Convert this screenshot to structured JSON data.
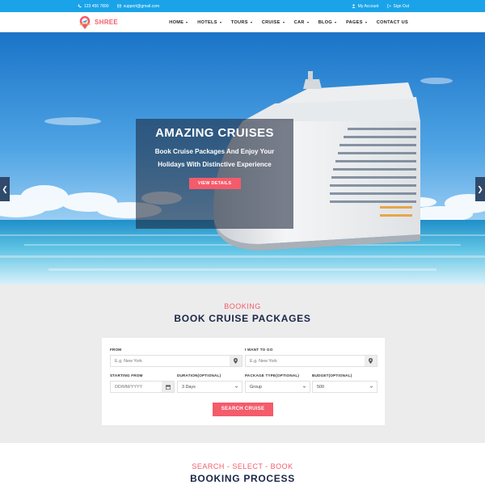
{
  "topbar": {
    "phone": "123 456 7890",
    "email": "support@gmail.com",
    "account": "My Account",
    "signout": "Sign Out"
  },
  "logo": {
    "text": "SHREE"
  },
  "menu": [
    {
      "label": "HOME",
      "dropdown": true
    },
    {
      "label": "HOTELS",
      "dropdown": true
    },
    {
      "label": "TOURS",
      "dropdown": true
    },
    {
      "label": "CRUISE",
      "dropdown": true
    },
    {
      "label": "CAR",
      "dropdown": true
    },
    {
      "label": "BLOG",
      "dropdown": true
    },
    {
      "label": "PAGES",
      "dropdown": true
    },
    {
      "label": "CONTACT US",
      "dropdown": false
    }
  ],
  "hero": {
    "title": "AMAZING CRUISES",
    "text": "Book Cruise Packages And Enjoy Your Holidays With Distinctive Experience",
    "button": "VIEW DETAILS"
  },
  "booking": {
    "subtitle": "BOOKING",
    "title": "BOOK CRUISE PACKAGES",
    "from_label": "FROM",
    "from_placeholder": "E.g. New York",
    "to_label": "I WANT TO GO",
    "to_placeholder": "E.g. New York",
    "start_label": "STARTING FROM",
    "start_placeholder": "DD/MM/YYYY",
    "duration_label": "DURATION(OPTIONAL)",
    "duration_value": "3 Days",
    "package_label": "PACKAGE TYPE(OPTIONAL)",
    "package_value": "Group",
    "budget_label": "BUDGET(OPTIONAL)",
    "budget_value": "500",
    "search_button": "SEARCH CRUISE"
  },
  "process": {
    "subtitle": "SEARCH - SELECT - BOOK",
    "title": "BOOKING PROCESS"
  },
  "colors": {
    "accent": "#f45b6b",
    "topbar": "#1aa3e8",
    "heading": "#1b2547"
  }
}
